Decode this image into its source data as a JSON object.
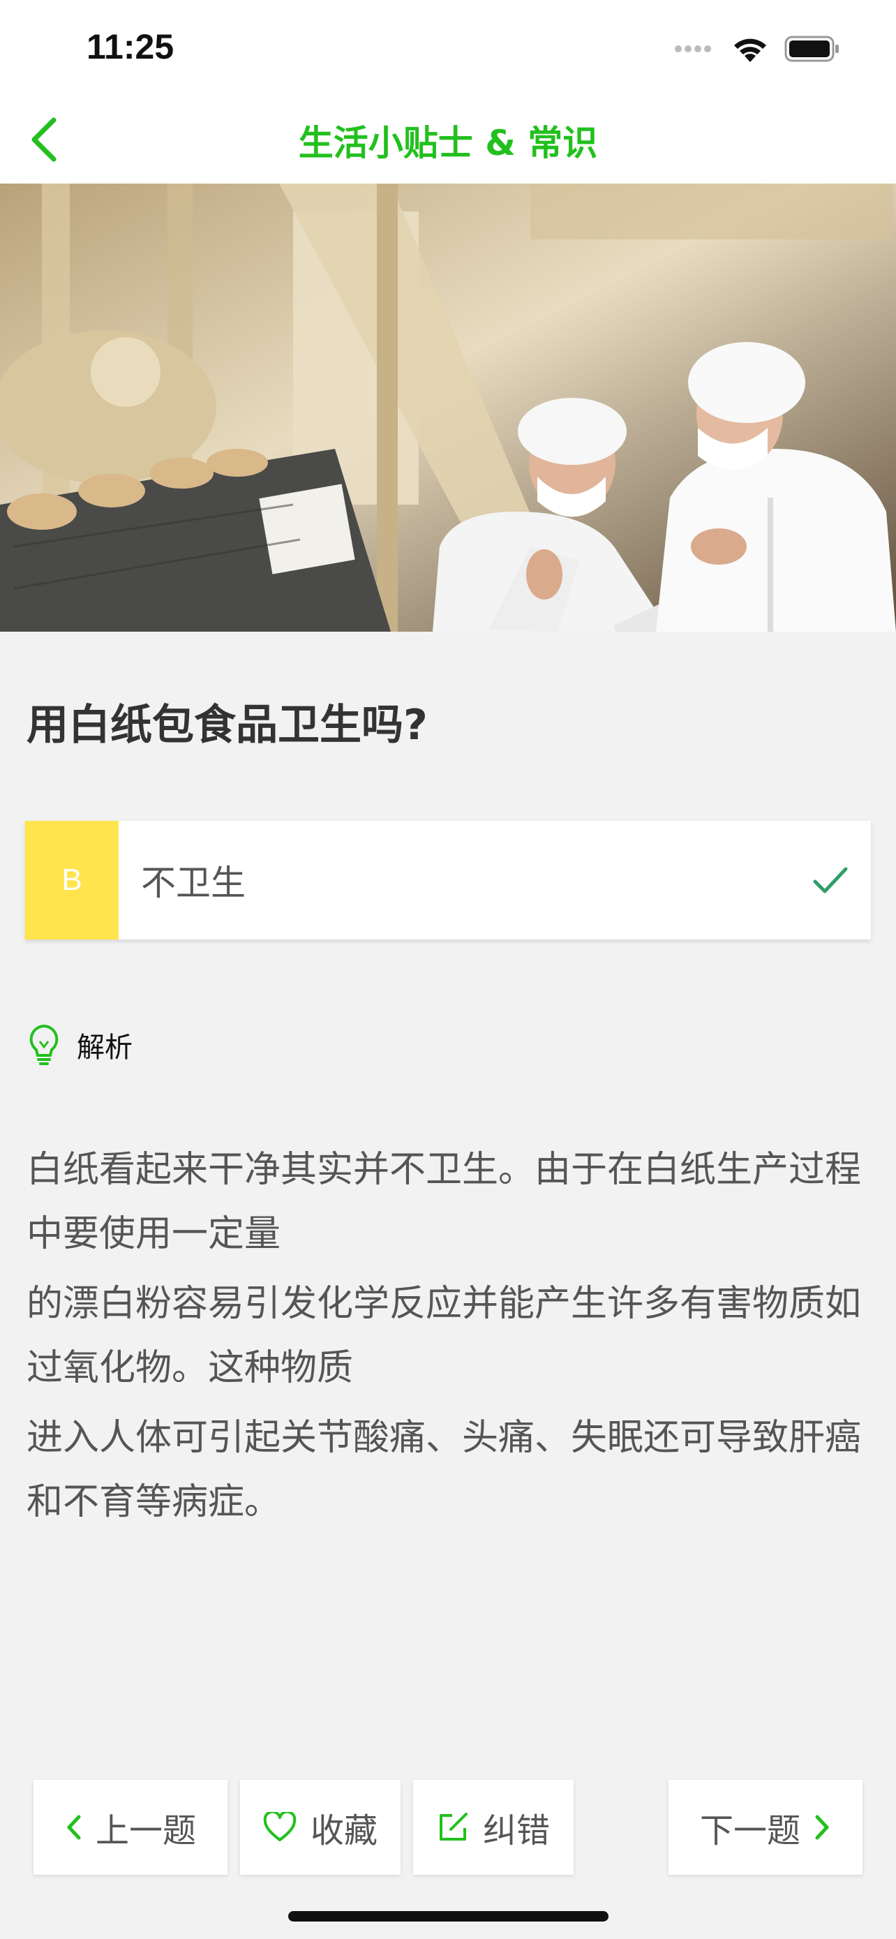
{
  "status_bar": {
    "time": "11:25"
  },
  "nav": {
    "title": "生活小贴士 & 常识"
  },
  "question": {
    "text": "用白纸包食品卫生吗?"
  },
  "answer": {
    "letter": "B",
    "text": "不卫生",
    "correct": true
  },
  "analysis": {
    "label": "解析",
    "paragraphs": [
      "白纸看起来干净其实并不卫生。由于在白纸生产过程中要使用一定量",
      "的漂白粉容易引发化学反应并能产生许多有害物质如过氧化物。这种物质",
      "进入人体可引起关节酸痛、头痛、失眠还可导致肝癌和不育等病症。"
    ]
  },
  "toolbar": {
    "prev_label": "上一题",
    "favorite_label": "收藏",
    "correct_label": "纠错",
    "next_label": "下一题"
  },
  "colors": {
    "accent": "#22c01e",
    "answer_letter_bg": "#ffe44d",
    "check": "#2e9e6a",
    "background": "#f2f2f2"
  },
  "icons": [
    "back-chevron-icon",
    "lightbulb-icon",
    "check-icon",
    "heart-icon",
    "edit-icon",
    "chevron-left-icon",
    "chevron-right-icon",
    "wifi-icon",
    "battery-icon",
    "signal-icon"
  ]
}
